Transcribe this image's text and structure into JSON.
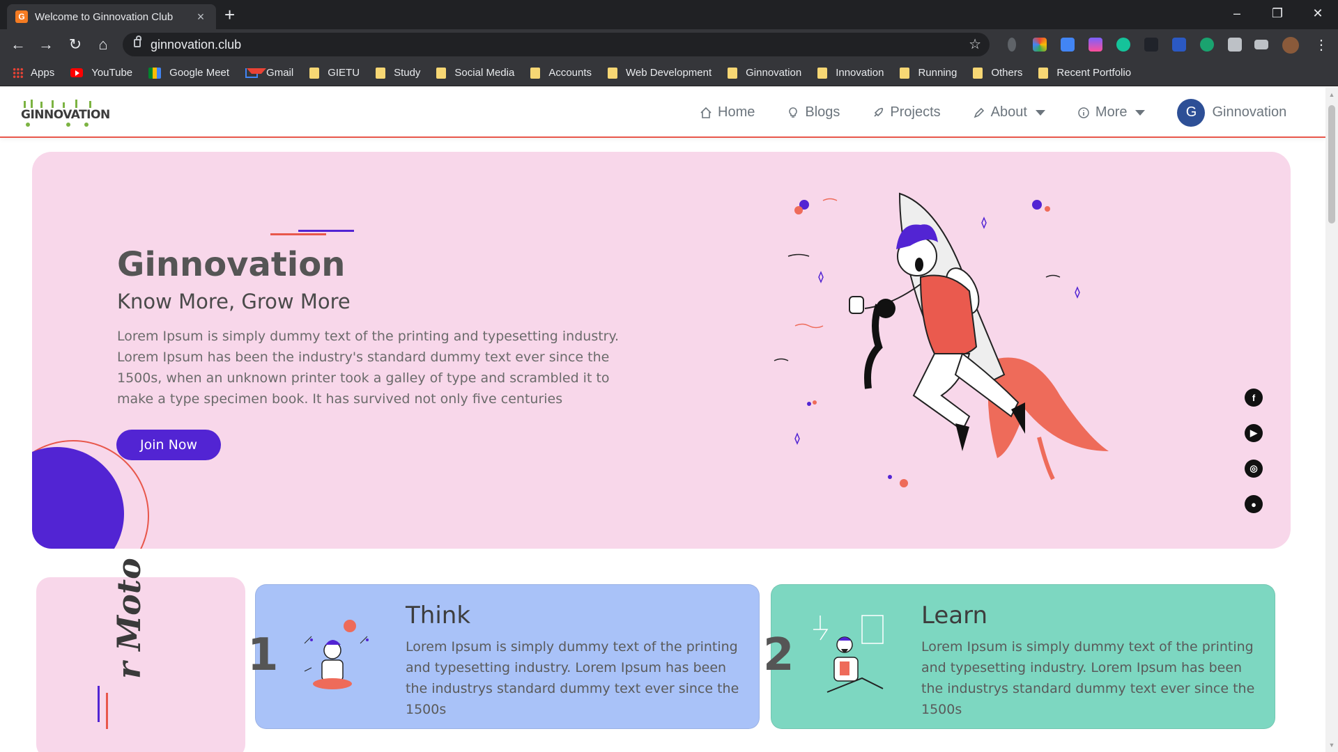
{
  "browser": {
    "tab_title": "Welcome to Ginnovation Club",
    "favicon_letter": "G",
    "url": "ginnovation.club",
    "window_controls": [
      "–",
      "❐",
      "✕"
    ]
  },
  "bookmarks": [
    "Apps",
    "YouTube",
    "Google Meet",
    "Gmail",
    "GIETU",
    "Study",
    "Social Media",
    "Accounts",
    "Web Development",
    "Ginnovation",
    "Innovation",
    "Running",
    "Others",
    "Recent Portfolio"
  ],
  "site": {
    "logo_text": "GINNOVATION",
    "menu": {
      "home": "Home",
      "blogs": "Blogs",
      "projects": "Projects",
      "about": "About",
      "more": "More",
      "user_initial": "G",
      "user_name": "Ginnovation"
    },
    "hero": {
      "title": "Ginnovation",
      "subtitle": "Know More, Grow More",
      "text": "Lorem Ipsum is simply dummy text of the printing and typesetting industry. Lorem Ipsum has been the industry's standard dummy text ever since the 1500s, when an unknown printer took a galley of type and scrambled it to make a type specimen book. It has survived not only five centuries",
      "cta": "Join Now"
    },
    "socials": [
      "facebook-icon",
      "youtube-icon",
      "instagram-icon",
      "github-icon"
    ],
    "moto": {
      "text": "r Moto"
    },
    "cards": [
      {
        "number": "1",
        "title": "Think",
        "text": "Lorem Ipsum is simply dummy text of the printing and typesetting industry. Lorem Ipsum has been the industrys standard dummy text ever since the 1500s"
      },
      {
        "number": "2",
        "title": "Learn",
        "text": "Lorem Ipsum is simply dummy text of the printing and typesetting industry. Lorem Ipsum has been the industrys standard dummy text ever since the 1500s"
      }
    ]
  },
  "colors": {
    "accent_purple": "#5224d3",
    "accent_red": "#e8574b",
    "hero_bg": "#f8d7ea",
    "think_bg": "#a9c2f8",
    "learn_bg": "#7dd7c1"
  }
}
